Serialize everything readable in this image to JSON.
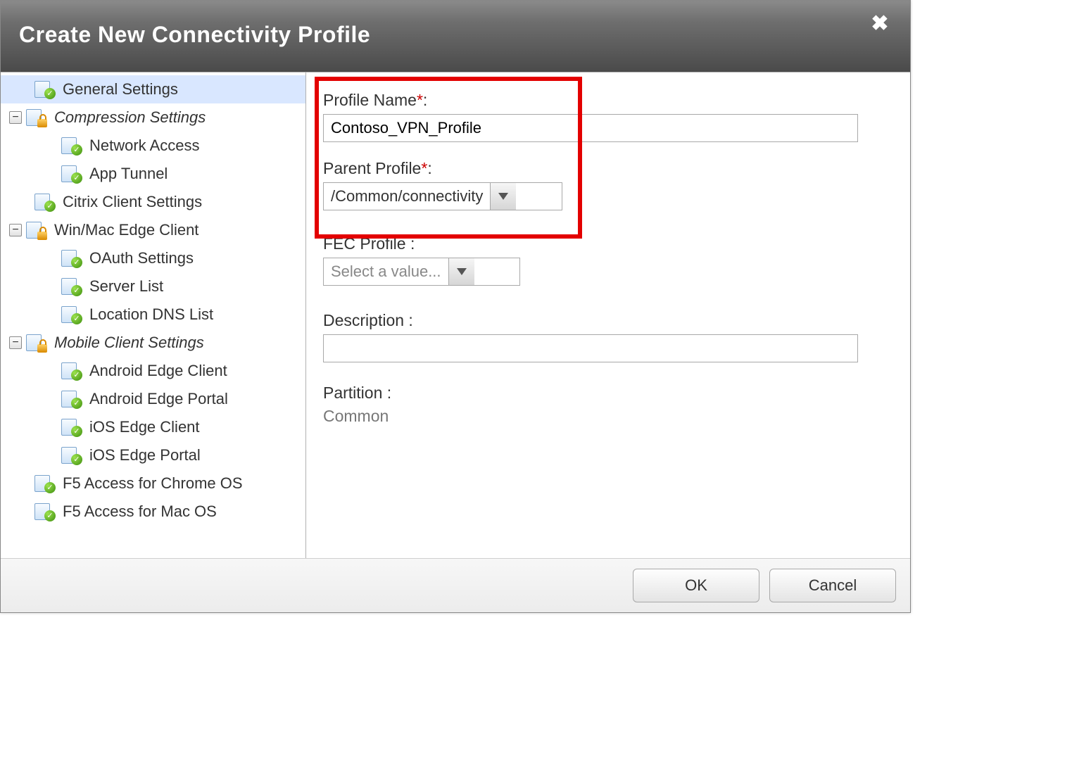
{
  "header": {
    "title": "Create New Connectivity Profile"
  },
  "tree": {
    "items": [
      {
        "label": "General Settings",
        "level": 1,
        "icon": "check",
        "selected": true
      },
      {
        "label": "Compression Settings",
        "level": 0,
        "icon": "lock",
        "italic": true,
        "expander": "minus"
      },
      {
        "label": "Network Access",
        "level": 2,
        "icon": "check"
      },
      {
        "label": "App Tunnel",
        "level": 2,
        "icon": "check"
      },
      {
        "label": "Citrix Client Settings",
        "level": 1,
        "icon": "check"
      },
      {
        "label": "Win/Mac Edge Client",
        "level": 0,
        "icon": "lock",
        "expander": "minus"
      },
      {
        "label": "OAuth Settings",
        "level": 2,
        "icon": "check"
      },
      {
        "label": "Server List",
        "level": 2,
        "icon": "check"
      },
      {
        "label": "Location DNS List",
        "level": 2,
        "icon": "check"
      },
      {
        "label": "Mobile Client Settings",
        "level": 0,
        "icon": "lock",
        "italic": true,
        "expander": "minus"
      },
      {
        "label": "Android Edge Client",
        "level": 2,
        "icon": "check"
      },
      {
        "label": "Android Edge Portal",
        "level": 2,
        "icon": "check"
      },
      {
        "label": "iOS Edge Client",
        "level": 2,
        "icon": "check"
      },
      {
        "label": "iOS Edge Portal",
        "level": 2,
        "icon": "check"
      },
      {
        "label": "F5 Access for Chrome OS",
        "level": 1,
        "icon": "check"
      },
      {
        "label": "F5 Access for Mac OS",
        "level": 1,
        "icon": "check"
      }
    ]
  },
  "form": {
    "profile_name_label": "Profile Name",
    "profile_name_value": "Contoso_VPN_Profile",
    "parent_profile_label": "Parent Profile",
    "parent_profile_value": "/Common/connectivity",
    "fec_profile_label": "FEC Profile",
    "fec_profile_placeholder": "Select a value...",
    "description_label": "Description",
    "description_value": "",
    "partition_label": "Partition",
    "partition_value": "Common",
    "colon": " :",
    "required_mark": "*"
  },
  "footer": {
    "ok": "OK",
    "cancel": "Cancel"
  },
  "glyphs": {
    "minus": "−",
    "check": "✓"
  }
}
